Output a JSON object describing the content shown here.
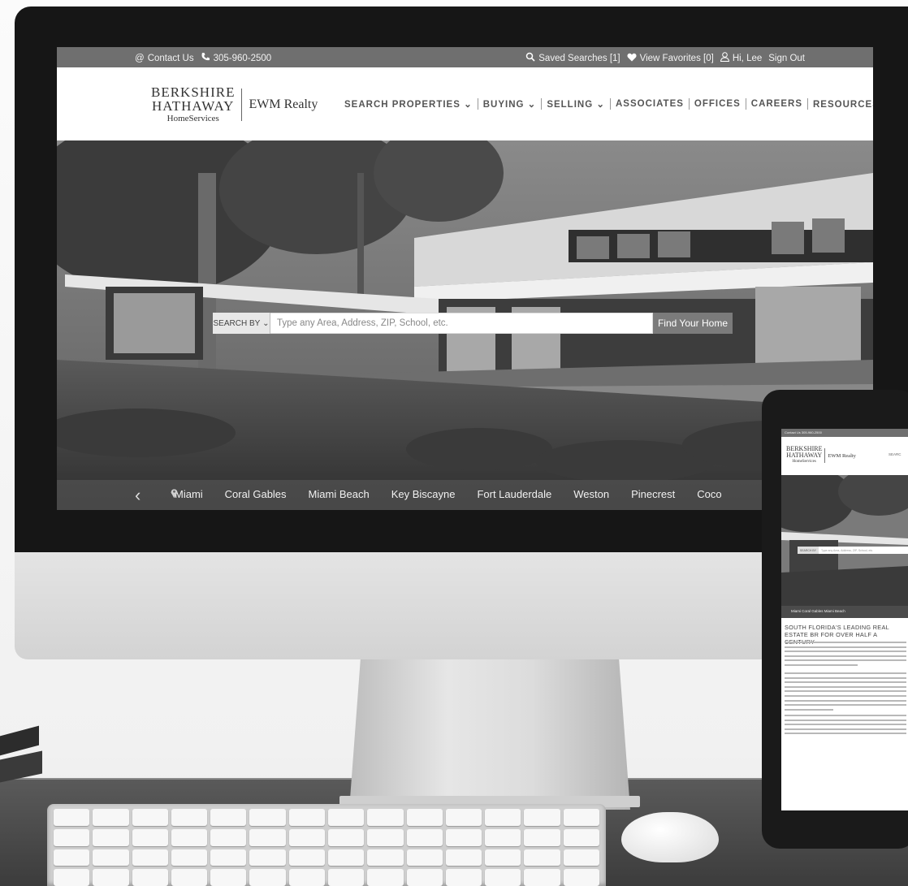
{
  "util_bar": {
    "contact": "Contact Us",
    "phone": "305-960-2500",
    "saved_searches": "Saved Searches [1]",
    "view_favorites": "View Favorites [0]",
    "greeting": "Hi, Lee",
    "sign_out": "Sign Out"
  },
  "brand": {
    "line1": "BERKSHIRE",
    "line2": "HATHAWAY",
    "line3": "HomeServices",
    "partner": "EWM Realty"
  },
  "nav": {
    "items": [
      {
        "label": "SEARCH PROPERTIES",
        "dropdown": true
      },
      {
        "label": "BUYING",
        "dropdown": true
      },
      {
        "label": "SELLING",
        "dropdown": true
      },
      {
        "label": "ASSOCIATES",
        "dropdown": false
      },
      {
        "label": "OFFICES",
        "dropdown": false
      },
      {
        "label": "CAREERS",
        "dropdown": false
      },
      {
        "label": "RESOURCES",
        "dropdown": true
      }
    ]
  },
  "search": {
    "search_by": "SEARCH BY",
    "placeholder": "Type any Area, Address, ZIP, School, etc.",
    "button": "Find Your Home"
  },
  "cities": [
    "Miami",
    "Coral Gables",
    "Miami Beach",
    "Key Biscayne",
    "Fort Lauderdale",
    "Weston",
    "Pinecrest",
    "Coco"
  ],
  "tablet": {
    "util": "Contact Us   305-960-2500",
    "nav_partial": "SEARC",
    "search_by": "SEARCH BY",
    "placeholder": "Type any Area, Address, ZIP, School, etc.",
    "cities": "Miami   Coral Gables   Miami Beach",
    "heading": "SOUTH FLORIDA'S LEADING REAL ESTATE BR FOR OVER HALF A CENTURY"
  }
}
